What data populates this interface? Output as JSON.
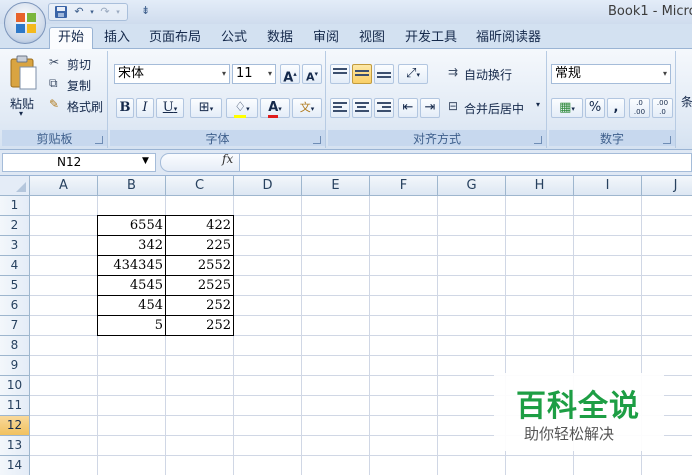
{
  "window": {
    "title": "Book1 - Micro"
  },
  "tabs": [
    {
      "label": "开始"
    },
    {
      "label": "插入"
    },
    {
      "label": "页面布局"
    },
    {
      "label": "公式"
    },
    {
      "label": "数据"
    },
    {
      "label": "审阅"
    },
    {
      "label": "视图"
    },
    {
      "label": "开发工具"
    },
    {
      "label": "福昕阅读器"
    }
  ],
  "ribbon": {
    "clipboard": {
      "paste": "粘贴",
      "cut": "剪切",
      "copy": "复制",
      "format_painter": "格式刷",
      "label": "剪贴板"
    },
    "font": {
      "name": "宋体",
      "size": "11",
      "grow": "A",
      "shrink": "A",
      "bold": "B",
      "italic": "I",
      "underline": "U",
      "label": "字体"
    },
    "alignment": {
      "wrap": "自动换行",
      "merge": "合并后居中",
      "label": "对齐方式"
    },
    "number": {
      "format": "常规",
      "percent": "%",
      "comma": ",",
      "inc_decimal": ".0 .00",
      "dec_decimal": ".00 .0",
      "label": "数字"
    },
    "styles": {
      "partial": "条"
    }
  },
  "formula_bar": {
    "cell_ref": "N12",
    "fx": "fx",
    "formula": ""
  },
  "sheet": {
    "columns": [
      "A",
      "B",
      "C",
      "D",
      "E",
      "F",
      "G",
      "H",
      "I",
      "J"
    ],
    "rows": [
      "1",
      "2",
      "3",
      "4",
      "5",
      "6",
      "7",
      "8",
      "9",
      "10",
      "11",
      "12",
      "13",
      "14"
    ],
    "selected_row": "12",
    "data": [
      {
        "b": "6554",
        "c": "422"
      },
      {
        "b": "342",
        "c": "225"
      },
      {
        "b": "434345",
        "c": "2552"
      },
      {
        "b": "4545",
        "c": "2525"
      },
      {
        "b": "454",
        "c": "252"
      },
      {
        "b": "5",
        "c": "252"
      }
    ]
  },
  "watermark": {
    "title": "百科全说",
    "subtitle": "助你轻松解决"
  }
}
